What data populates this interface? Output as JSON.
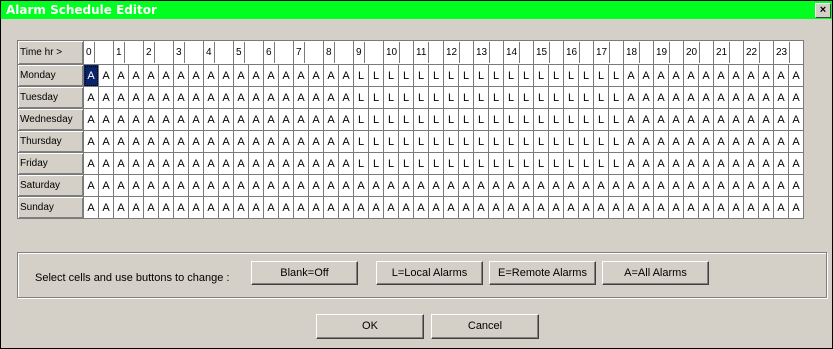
{
  "window": {
    "title": "Alarm Schedule Editor",
    "close_glyph": "×"
  },
  "grid": {
    "corner_label": "Time hr >",
    "hours": [
      "0",
      "1",
      "2",
      "3",
      "4",
      "5",
      "6",
      "7",
      "8",
      "9",
      "10",
      "11",
      "12",
      "13",
      "14",
      "15",
      "16",
      "17",
      "18",
      "19",
      "20",
      "21",
      "22",
      "23"
    ],
    "selected": {
      "day": "Monday",
      "cell": 0
    },
    "rows": [
      {
        "day": "Monday",
        "cells": "AAAAAAAAAAAAAAAAAALLLLLLLLLLLLLLLLLLAAAAAAAAAAAAAA"
      },
      {
        "day": "Tuesday",
        "cells": "AAAAAAAAAAAAAAAAAALLLLLLLLLLLLLLLLLLAAAAAAAAAAAAAA"
      },
      {
        "day": "Wednesday",
        "cells": "AAAAAAAAAAAAAAAAAALLLLLLLLLLLLLLLLLLAAAAAAAAAAAAAA"
      },
      {
        "day": "Thursday",
        "cells": "AAAAAAAAAAAAAAAAAALLLLLLLLLLLLLLLLLLAAAAAAAAAAAAAA"
      },
      {
        "day": "Friday",
        "cells": "AAAAAAAAAAAAAAAAAALLLLLLLLLLLLLLLLLLAAAAAAAAAAAAAA"
      },
      {
        "day": "Saturday",
        "cells": "AAAAAAAAAAAAAAAAAAAAAAAAAAAAAAAAAAAAAAAAAAAAAAAAAA"
      },
      {
        "day": "Sunday",
        "cells": "AAAAAAAAAAAAAAAAAAAAAAAAAAAAAAAAAAAAAAAAAAAAAAAAAA"
      }
    ]
  },
  "controls": {
    "instruction": "Select cells and use buttons to change :",
    "blank_label": "Blank=Off",
    "local_label": "L=Local Alarms",
    "remote_label": "E=Remote Alarms",
    "all_label": "A=All Alarms"
  },
  "footer": {
    "ok_label": "OK",
    "cancel_label": "Cancel"
  },
  "colors": {
    "titlebar": "#00ff21",
    "face": "#d4d0c8",
    "selection": "#0a246a"
  }
}
